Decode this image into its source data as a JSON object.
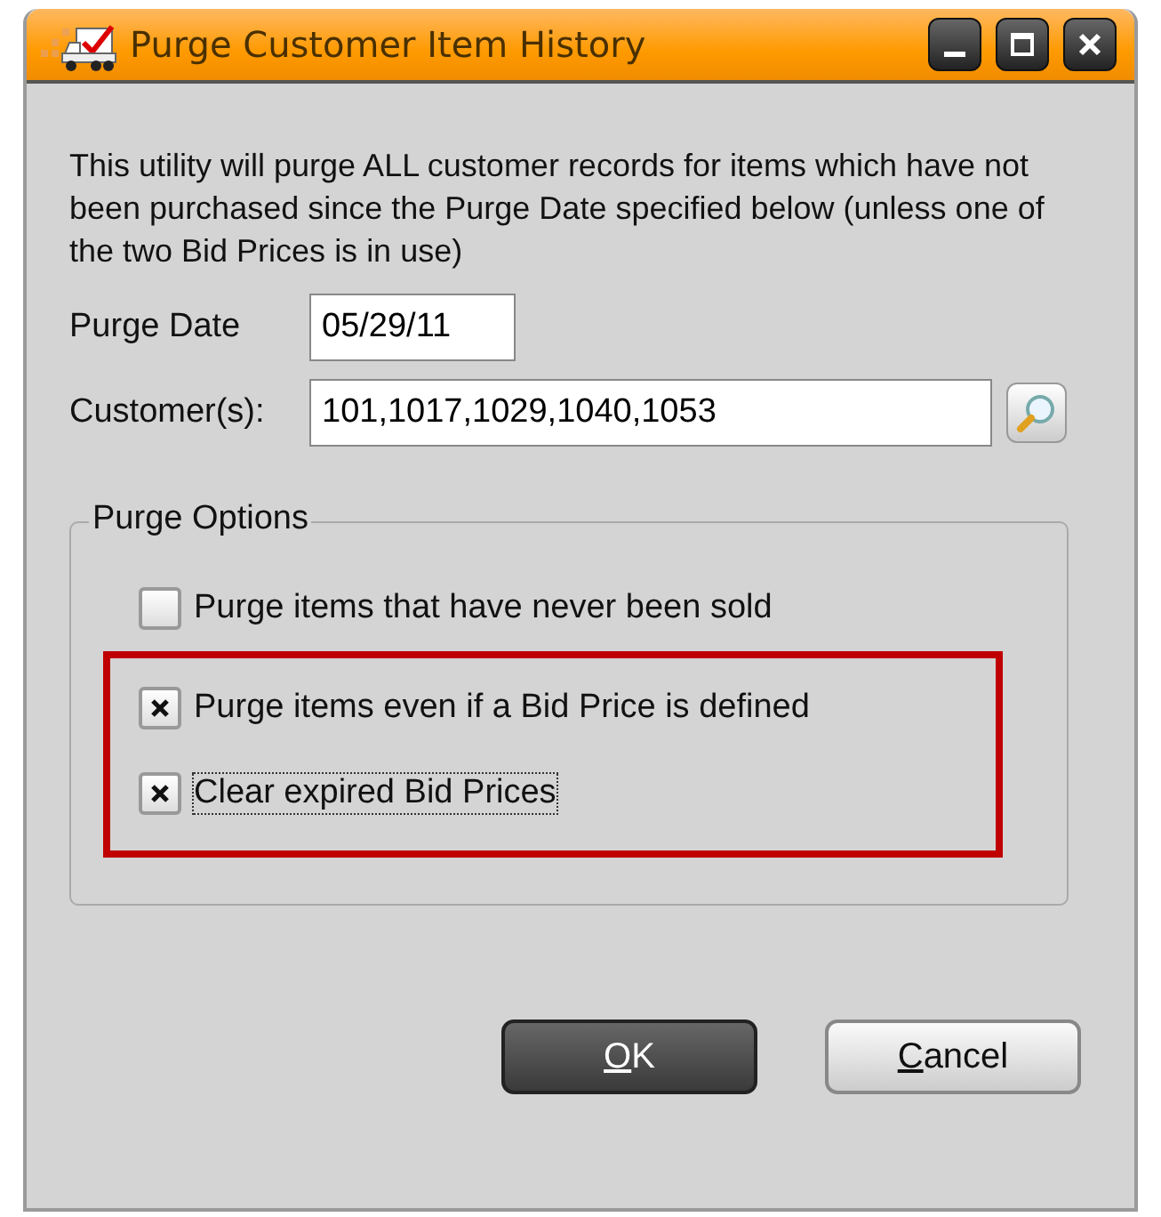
{
  "window": {
    "title": "Purge Customer Item History"
  },
  "description": "This utility will purge ALL customer records for items which have not been purchased since the Purge Date specified below (unless one of the two Bid Prices is in use)",
  "purge_date": {
    "label": "Purge Date",
    "value": "05/29/11"
  },
  "customers": {
    "label": "Customer(s):",
    "value": "101,1017,1029,1040,1053"
  },
  "purge_options": {
    "title": "Purge Options",
    "options": [
      {
        "label": "Purge items that have never been sold",
        "checked": false,
        "highlighted": false,
        "focused": false
      },
      {
        "label": "Purge items even if a Bid Price is defined",
        "checked": true,
        "highlighted": true,
        "focused": false
      },
      {
        "label": "Clear expired Bid Prices",
        "checked": true,
        "highlighted": true,
        "focused": true
      }
    ]
  },
  "buttons": [
    {
      "label": "OK",
      "default": true
    },
    {
      "label": "Cancel",
      "default": false
    }
  ]
}
